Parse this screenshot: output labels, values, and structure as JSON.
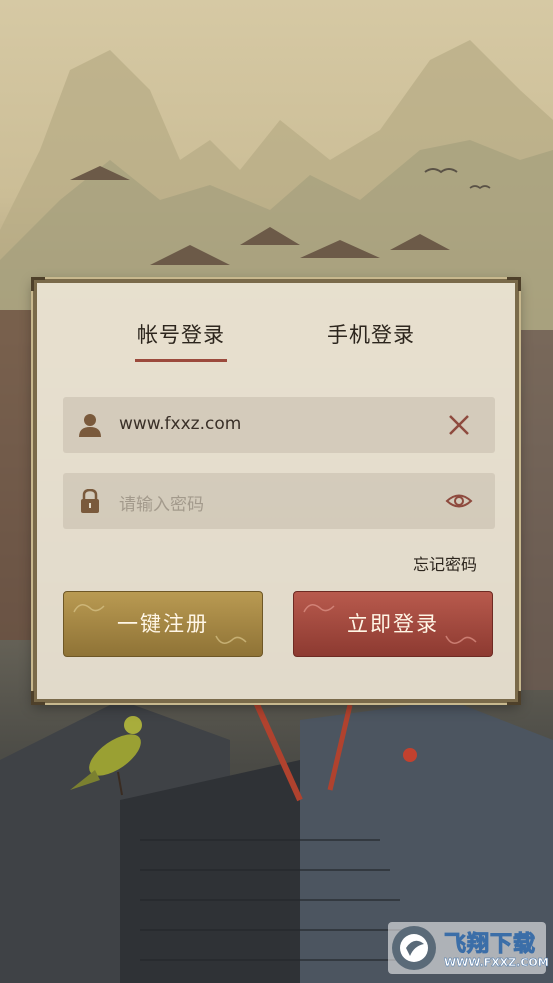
{
  "tabs": [
    {
      "label": "帐号登录",
      "active": true
    },
    {
      "label": "手机登录",
      "active": false
    }
  ],
  "account_field": {
    "value": "www.fxxz.com",
    "clear_icon": "close-icon",
    "user_icon": "user-icon"
  },
  "password_field": {
    "placeholder": "请输入密码",
    "lock_icon": "lock-icon",
    "toggle_icon": "eye-icon"
  },
  "forgot_password": "忘记密码",
  "buttons": {
    "register": "一键注册",
    "login": "立即登录"
  },
  "watermark": {
    "title": "飞翔下载",
    "url": "WWW.FXXZ.COM"
  },
  "colors": {
    "accent": "#9c4a3c",
    "register_btn": "#a4853f",
    "login_btn": "#a34a3e",
    "panel": "#ece4d4"
  }
}
